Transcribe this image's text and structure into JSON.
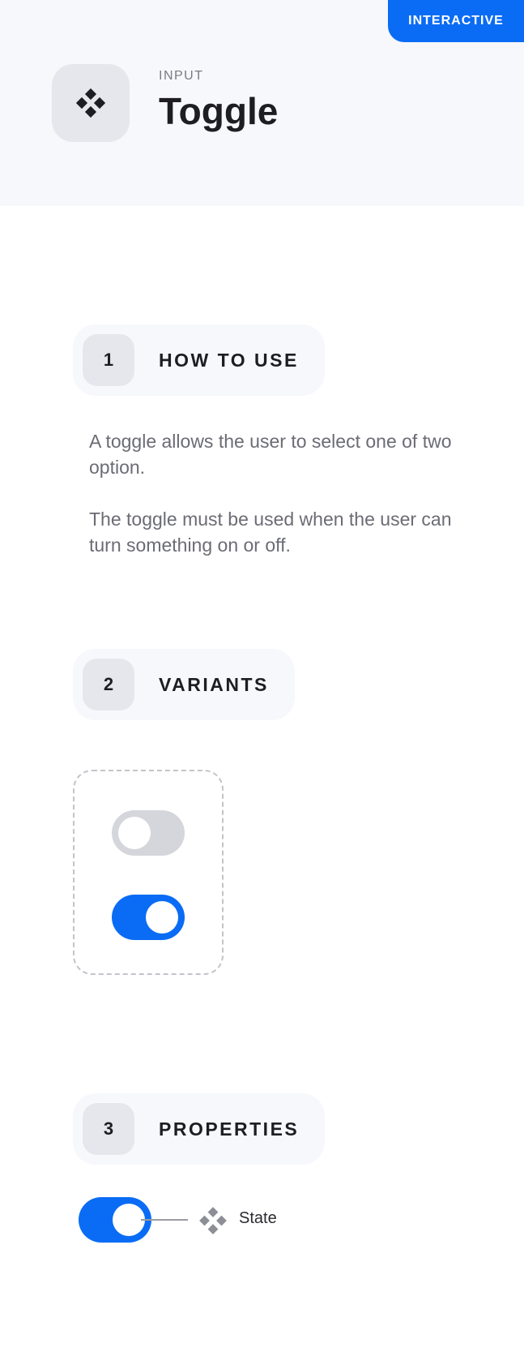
{
  "header": {
    "badge": "INTERACTIVE",
    "category": "INPUT",
    "title": "Toggle",
    "icon": "component-diamond-icon"
  },
  "sections": [
    {
      "number": "1",
      "title": "HOW TO USE"
    },
    {
      "number": "2",
      "title": "VARIANTS"
    },
    {
      "number": "3",
      "title": "PROPERTIES"
    }
  ],
  "how_to_use": {
    "paragraphs": [
      "A toggle allows the user to select one of two option.",
      "The toggle must be used when the user can turn something on or off."
    ]
  },
  "variants": [
    {
      "state": "off"
    },
    {
      "state": "on"
    }
  ],
  "properties": {
    "label": "State",
    "icon": "component-diamond-icon",
    "toggle_state": "on"
  },
  "colors": {
    "accent": "#0a6cf5",
    "toggle_off": "#d5d6db",
    "header_bg": "#f7f8fc"
  }
}
